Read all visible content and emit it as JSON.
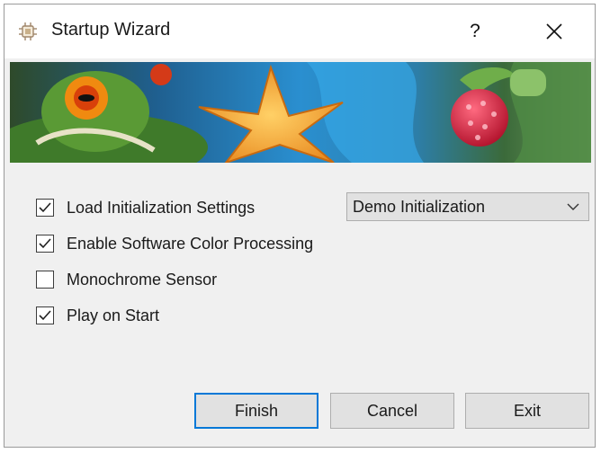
{
  "window": {
    "title": "Startup Wizard"
  },
  "titlebar": {
    "help_symbol": "?",
    "close_icon": "close-icon"
  },
  "banner": {
    "description_icons": [
      "frog",
      "starfish",
      "raspberry"
    ]
  },
  "options": [
    {
      "label": "Load Initialization Settings",
      "checked": true
    },
    {
      "label": "Enable Software Color Processing",
      "checked": true
    },
    {
      "label": "Monochrome Sensor",
      "checked": false
    },
    {
      "label": "Play on Start",
      "checked": true
    }
  ],
  "init_select": {
    "value": "Demo Initialization"
  },
  "buttons": {
    "finish": "Finish",
    "cancel": "Cancel",
    "exit": "Exit"
  },
  "colors": {
    "focus_border": "#0078d7",
    "dialog_bg": "#f0f0f0",
    "button_bg": "#e1e1e1"
  }
}
